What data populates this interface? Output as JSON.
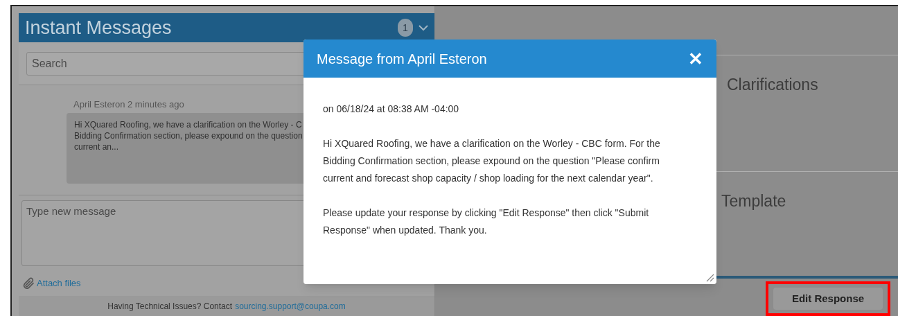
{
  "chat_panel": {
    "title": "Instant Messages",
    "unread_count": "1",
    "search": {
      "placeholder": "Search"
    },
    "messages": [
      {
        "meta": "April Esteron 2 minutes ago",
        "lines": [
          "Hi XQuared Roofing, we have a clarification on the Worley - C",
          "Bidding Confirmation section, please expound on the question",
          "current an..."
        ]
      }
    ],
    "compose": {
      "placeholder": "Type new message"
    },
    "attach_link": "Attach files",
    "footer": {
      "text": "Having Technical Issues? Contact",
      "link": "sourcing.support@coupa.com"
    }
  },
  "background_sections": [
    "Clarifications",
    "Template"
  ],
  "edit_button": {
    "label": "Edit Response",
    "highlighted": true
  },
  "dialog": {
    "title": "Message from April Esteron",
    "close": "✕",
    "date": "on 06/18/24 at 08:38 AM -04:00",
    "paragraphs": [
      "Hi XQuared Roofing, we have a clarification on the Worley - CBC form. For the Bidding Confirmation section, please expound on the question \"Please confirm current and forecast shop capacity / shop loading for the next calendar year\".",
      "Please update your response by clicking \"Edit Response\" then click \"Submit Response\" when updated. Thank you."
    ]
  }
}
